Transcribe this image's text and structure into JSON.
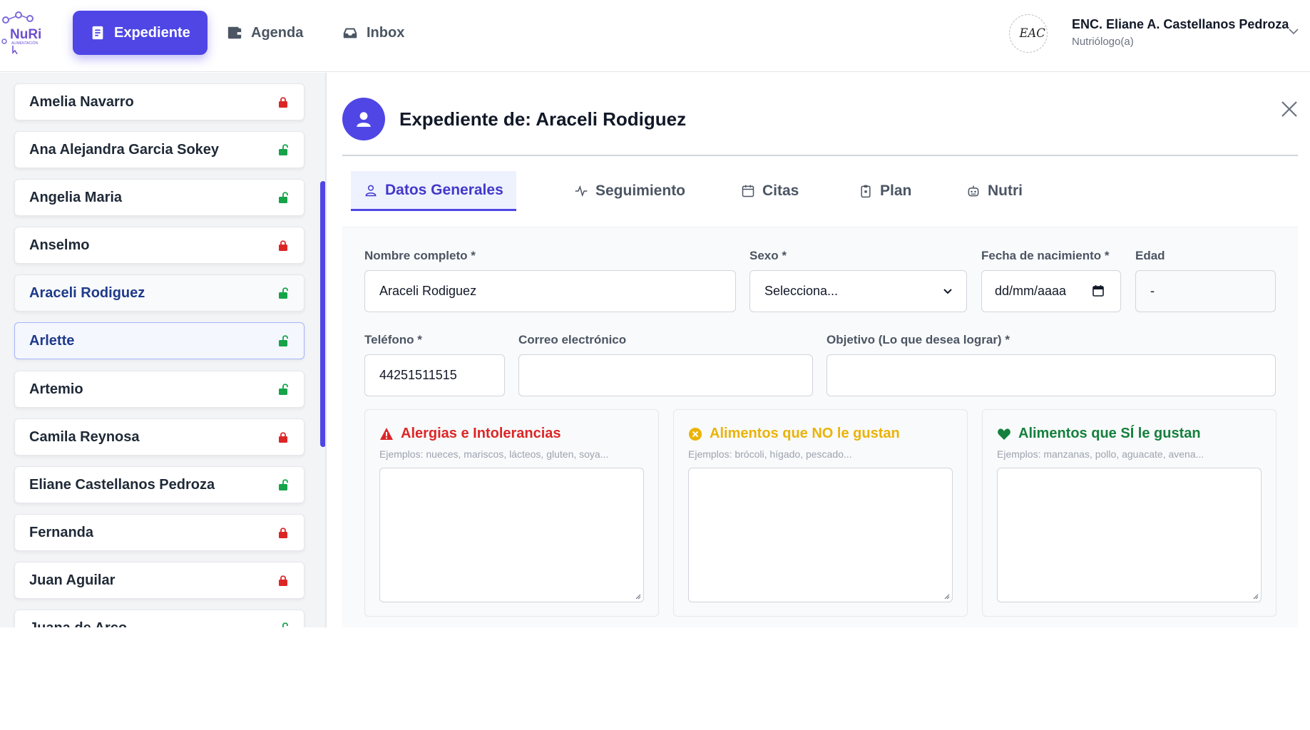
{
  "app": {
    "logo_text": "NuRi",
    "logo_subtext": "ALIMENTACIÓN"
  },
  "nav": {
    "items": [
      {
        "label": "Expediente",
        "icon": "document-icon",
        "active": true
      },
      {
        "label": "Agenda",
        "icon": "wallet-icon",
        "active": false
      },
      {
        "label": "Inbox",
        "icon": "inbox-icon",
        "active": false
      }
    ]
  },
  "user": {
    "name": "ENC. Eliane A. Castellanos Pedroza",
    "role": "Nutriólogo(a)",
    "avatar_initials": "EAC"
  },
  "patients": [
    {
      "name": "Amelia Navarro",
      "lock": "locked"
    },
    {
      "name": "Ana Alejandra Garcia Sokey",
      "lock": "unlocked"
    },
    {
      "name": "Angelia Maria",
      "lock": "unlocked"
    },
    {
      "name": "Anselmo",
      "lock": "locked"
    },
    {
      "name": "Araceli Rodiguez",
      "lock": "unlocked"
    },
    {
      "name": "Arlette",
      "lock": "unlocked"
    },
    {
      "name": "Artemio",
      "lock": "unlocked"
    },
    {
      "name": "Camila Reynosa",
      "lock": "locked"
    },
    {
      "name": "Eliane Castellanos Pedroza",
      "lock": "unlocked"
    },
    {
      "name": "Fernanda",
      "lock": "locked"
    },
    {
      "name": "Juan Aguilar",
      "lock": "locked"
    },
    {
      "name": "Juana de Arco",
      "lock": "unlocked"
    }
  ],
  "record": {
    "title": "Expediente de: Araceli Rodiguez",
    "tabs": [
      {
        "label": "Datos Generales",
        "icon": "user-icon",
        "active": true
      },
      {
        "label": "Seguimiento",
        "icon": "activity-icon",
        "active": false
      },
      {
        "label": "Citas",
        "icon": "calendar-icon",
        "active": false
      },
      {
        "label": "Plan",
        "icon": "clipboard-icon",
        "active": false
      },
      {
        "label": "Nutri",
        "icon": "robot-icon",
        "active": false
      }
    ]
  },
  "form": {
    "nombre_label": "Nombre completo *",
    "nombre_value": "Araceli Rodiguez",
    "sexo_label": "Sexo *",
    "sexo_value": "Selecciona...",
    "fecha_label": "Fecha de nacimiento *",
    "fecha_value": "dd/mm/aaaa",
    "edad_label": "Edad",
    "edad_value": "-",
    "telefono_label": "Teléfono *",
    "telefono_value": "44251511515",
    "correo_label": "Correo electrónico",
    "correo_value": "",
    "objetivo_label": "Objetivo (Lo que desea lograr) *",
    "objetivo_value": ""
  },
  "preferences": [
    {
      "title": "Alergias e Intolerancias",
      "hint": "Ejemplos: nueces, mariscos, lácteos, gluten, soya...",
      "icon": "warning-icon",
      "color": "#dc2626"
    },
    {
      "title": "Alimentos que NO le gustan",
      "hint": "Ejemplos: brócoli, hígado, pescado...",
      "icon": "x-circle-icon",
      "color": "#eab308"
    },
    {
      "title": "Alimentos que SÍ le gustan",
      "hint": "Ejemplos: manzanas, pollo, aguacate, avena...",
      "icon": "heart-icon",
      "color": "#15803d"
    }
  ],
  "colors": {
    "accent": "#4f46e5",
    "locked": "#dc2626",
    "unlocked": "#16a34a"
  }
}
